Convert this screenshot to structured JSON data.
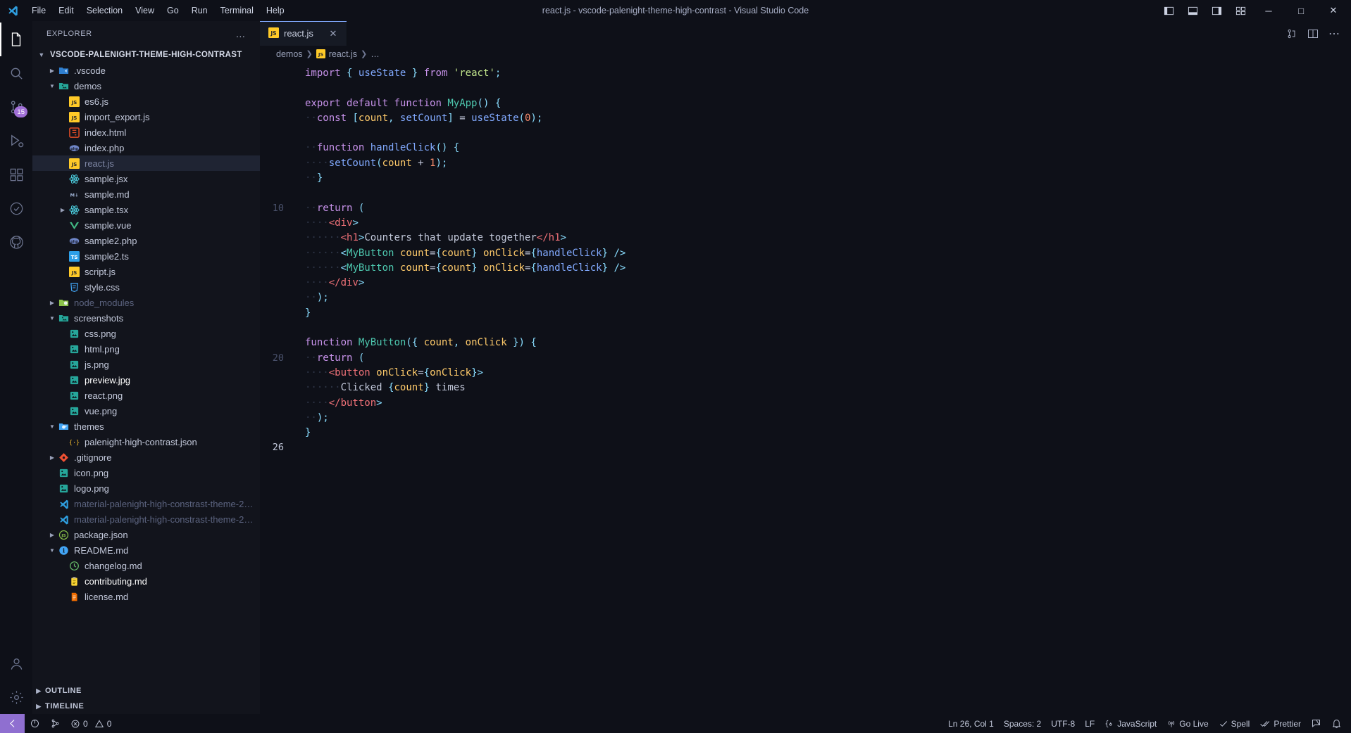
{
  "window": {
    "title": "react.js - vscode-palenight-theme-high-contrast - Visual Studio Code",
    "menu": [
      "File",
      "Edit",
      "Selection",
      "View",
      "Go",
      "Run",
      "Terminal",
      "Help"
    ],
    "layout_buttons": [
      "toggle-primary-sidebar",
      "toggle-panel",
      "toggle-secondary-sidebar",
      "customize-layout"
    ],
    "controls": {
      "minimize": "─",
      "maximize": "□",
      "close": "✕"
    }
  },
  "activitybar": {
    "items": [
      {
        "name": "explorer",
        "glyph": "files",
        "active": true,
        "badge": ""
      },
      {
        "name": "search",
        "glyph": "search",
        "active": false,
        "badge": ""
      },
      {
        "name": "source-control",
        "glyph": "git",
        "active": false,
        "badge": "15"
      },
      {
        "name": "run-and-debug",
        "glyph": "debug",
        "active": false,
        "badge": ""
      },
      {
        "name": "extensions",
        "glyph": "extensions",
        "active": false,
        "badge": ""
      },
      {
        "name": "testing",
        "glyph": "beaker",
        "active": false,
        "badge": ""
      },
      {
        "name": "github",
        "glyph": "github",
        "active": false,
        "badge": ""
      }
    ],
    "bottom": [
      {
        "name": "accounts",
        "glyph": "account"
      },
      {
        "name": "manage",
        "glyph": "gear"
      }
    ]
  },
  "sidebar": {
    "title": "EXPLORER",
    "more_actions": "…",
    "root": {
      "label": "VSCODE-PALENIGHT-THEME-HIGH-CONTRAST",
      "expanded": true
    },
    "tree": [
      {
        "label": ".vscode",
        "depth": 1,
        "type": "folder",
        "state": "collapsed",
        "icon": "folder-vscode",
        "color": "#c3c9db"
      },
      {
        "label": "demos",
        "depth": 1,
        "type": "folder",
        "state": "expanded",
        "icon": "folder-images",
        "color": "#c3c9db"
      },
      {
        "label": "es6.js",
        "depth": 2,
        "type": "file",
        "icon": "js",
        "color": "#c3c9db"
      },
      {
        "label": "import_export.js",
        "depth": 2,
        "type": "file",
        "icon": "js",
        "color": "#c3c9db"
      },
      {
        "label": "index.html",
        "depth": 2,
        "type": "file",
        "icon": "html",
        "color": "#c3c9db"
      },
      {
        "label": "index.php",
        "depth": 2,
        "type": "file",
        "icon": "php",
        "color": "#c3c9db"
      },
      {
        "label": "react.js",
        "depth": 2,
        "type": "file",
        "icon": "js",
        "color": "#7d85a3",
        "selected": true
      },
      {
        "label": "sample.jsx",
        "depth": 2,
        "type": "file",
        "icon": "react",
        "color": "#c3c9db"
      },
      {
        "label": "sample.md",
        "depth": 2,
        "type": "file",
        "icon": "md",
        "color": "#c3c9db"
      },
      {
        "label": "sample.tsx",
        "depth": 2,
        "type": "file",
        "icon": "react",
        "color": "#c3c9db",
        "state": "collapsed"
      },
      {
        "label": "sample.vue",
        "depth": 2,
        "type": "file",
        "icon": "vue",
        "color": "#c3c9db"
      },
      {
        "label": "sample2.php",
        "depth": 2,
        "type": "file",
        "icon": "php",
        "color": "#c3c9db"
      },
      {
        "label": "sample2.ts",
        "depth": 2,
        "type": "file",
        "icon": "ts",
        "color": "#c3c9db"
      },
      {
        "label": "script.js",
        "depth": 2,
        "type": "file",
        "icon": "js",
        "color": "#c3c9db"
      },
      {
        "label": "style.css",
        "depth": 2,
        "type": "file",
        "icon": "css",
        "color": "#c3c9db"
      },
      {
        "label": "node_modules",
        "depth": 1,
        "type": "folder",
        "state": "collapsed",
        "icon": "folder-node",
        "color": "#5c6480"
      },
      {
        "label": "screenshots",
        "depth": 1,
        "type": "folder",
        "state": "expanded",
        "icon": "folder-images",
        "color": "#c3c9db"
      },
      {
        "label": "css.png",
        "depth": 2,
        "type": "file",
        "icon": "image",
        "color": "#c3c9db"
      },
      {
        "label": "html.png",
        "depth": 2,
        "type": "file",
        "icon": "image",
        "color": "#c3c9db"
      },
      {
        "label": "js.png",
        "depth": 2,
        "type": "file",
        "icon": "image",
        "color": "#c3c9db"
      },
      {
        "label": "preview.jpg",
        "depth": 2,
        "type": "file",
        "icon": "image",
        "color": "#ffffff"
      },
      {
        "label": "react.png",
        "depth": 2,
        "type": "file",
        "icon": "image",
        "color": "#c3c9db"
      },
      {
        "label": "vue.png",
        "depth": 2,
        "type": "file",
        "icon": "image",
        "color": "#c3c9db"
      },
      {
        "label": "themes",
        "depth": 1,
        "type": "folder",
        "state": "expanded",
        "icon": "folder-theme",
        "color": "#c3c9db"
      },
      {
        "label": "palenight-high-contrast.json",
        "depth": 2,
        "type": "file",
        "icon": "json",
        "color": "#c3c9db"
      },
      {
        "label": ".gitignore",
        "depth": 1,
        "type": "file",
        "icon": "git",
        "color": "#c3c9db",
        "state": "collapsed"
      },
      {
        "label": "icon.png",
        "depth": 1,
        "type": "file",
        "icon": "image",
        "color": "#c3c9db"
      },
      {
        "label": "logo.png",
        "depth": 1,
        "type": "file",
        "icon": "image",
        "color": "#c3c9db"
      },
      {
        "label": "material-palenight-high-constrast-theme-2…",
        "depth": 1,
        "type": "file",
        "icon": "vsix",
        "color": "#5c6480"
      },
      {
        "label": "material-palenight-high-constrast-theme-2…",
        "depth": 1,
        "type": "file",
        "icon": "vsix",
        "color": "#5c6480"
      },
      {
        "label": "package.json",
        "depth": 1,
        "type": "file",
        "icon": "nodejson",
        "color": "#c3c9db",
        "state": "collapsed"
      },
      {
        "label": "README.md",
        "depth": 1,
        "type": "file",
        "icon": "readme",
        "color": "#c3c9db",
        "state": "expanded"
      },
      {
        "label": "changelog.md",
        "depth": 2,
        "type": "file",
        "icon": "changelog",
        "color": "#c3c9db"
      },
      {
        "label": "contributing.md",
        "depth": 2,
        "type": "file",
        "icon": "contributing",
        "color": "#ffffff"
      },
      {
        "label": "license.md",
        "depth": 2,
        "type": "file",
        "icon": "license",
        "color": "#c3c9db"
      }
    ],
    "panels": [
      {
        "label": "OUTLINE",
        "state": "collapsed"
      },
      {
        "label": "TIMELINE",
        "state": "collapsed"
      }
    ]
  },
  "editor": {
    "tabs": [
      {
        "label": "react.js",
        "icon": "js",
        "active": true,
        "close": "✕"
      }
    ],
    "tab_actions": [
      "split-editor",
      "open-changes",
      "more-actions"
    ],
    "breadcrumbs": [
      {
        "label": "demos",
        "icon": ""
      },
      {
        "label": "react.js",
        "icon": "js"
      },
      {
        "label": "…",
        "icon": ""
      }
    ],
    "line_numbers": [
      "",
      "",
      "",
      "",
      "",
      "",
      "",
      "",
      "",
      "10",
      "",
      "",
      "",
      "",
      "",
      "",
      "",
      "",
      "",
      "20",
      "",
      "",
      "",
      "",
      "",
      "26"
    ],
    "visible_line_labels": {
      "10": "10",
      "20": "20",
      "26": "26"
    },
    "code_lines": [
      "import { useState } from 'react';",
      "",
      "export default function MyApp() {",
      "  const [count, setCount] = useState(0);",
      "",
      "  function handleClick() {",
      "    setCount(count + 1);",
      "  }",
      "",
      "  return (",
      "    <div>",
      "      <h1>Counters that update together</h1>",
      "      <MyButton count={count} onClick={handleClick} />",
      "      <MyButton count={count} onClick={handleClick} />",
      "    </div>",
      "  );",
      "}",
      "",
      "function MyButton({ count, onClick }) {",
      "  return (",
      "    <button onClick={onClick}>",
      "      Clicked {count} times",
      "    </button>",
      "  );",
      "}",
      ""
    ]
  },
  "statusbar": {
    "remote_icon": "remote-indicator",
    "left": [
      {
        "name": "sync",
        "icon": "sync",
        "label": ""
      },
      {
        "name": "live-share",
        "icon": "live-share",
        "label": ""
      },
      {
        "name": "problems",
        "icon": "errors-warnings",
        "label": "0 ⚠ 0",
        "errors": "0",
        "warnings": "0"
      }
    ],
    "right": [
      {
        "name": "cursor-position",
        "label": "Ln 26, Col 1"
      },
      {
        "name": "indentation",
        "label": "Spaces: 2"
      },
      {
        "name": "encoding",
        "label": "UTF-8"
      },
      {
        "name": "eol",
        "label": "LF"
      },
      {
        "name": "language-mode",
        "label": "JavaScript",
        "icon": "js-braces"
      },
      {
        "name": "go-live",
        "label": "Go Live",
        "icon": "broadcast"
      },
      {
        "name": "spell-checker",
        "label": "Spell",
        "icon": "check"
      },
      {
        "name": "prettier",
        "label": "Prettier",
        "icon": "double-check"
      },
      {
        "name": "remote-feedback",
        "label": "",
        "icon": "feedback"
      },
      {
        "name": "notifications",
        "label": "",
        "icon": "bell"
      }
    ]
  },
  "colors": {
    "background": "#0e1018",
    "sidebar": "#12141c",
    "tab_active": "#161a24",
    "accent": "#82aaff",
    "badge": "#a06fd6",
    "remote": "#8f6fd0"
  }
}
